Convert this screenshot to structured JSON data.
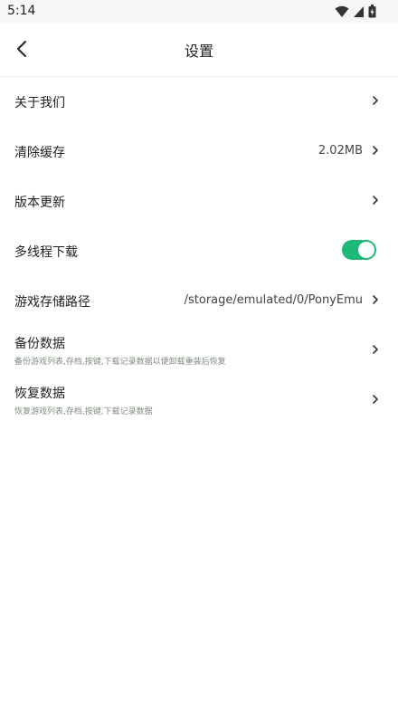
{
  "status_bar": {
    "time": "5:14",
    "icons": [
      "wifi-icon",
      "signal-icon",
      "battery-icon"
    ]
  },
  "header": {
    "title": "设置",
    "back_icon": "back-arrow-icon"
  },
  "settings": {
    "about": {
      "label": "关于我们"
    },
    "clear_cache": {
      "label": "清除缓存",
      "value": "2.02MB"
    },
    "version_update": {
      "label": "版本更新"
    },
    "multi_thread": {
      "label": "多线程下载",
      "enabled": true
    },
    "storage_path": {
      "label": "游戏存储路径",
      "value": "/storage/emulated/0/PonyEmu"
    },
    "backup": {
      "label": "备份数据",
      "sub": "备份游戏列表,存档,按键,下载记录数据以便卸载重装后恢复"
    },
    "restore": {
      "label": "恢复数据",
      "sub": "恢复游戏列表,存档,按键,下载记录数据"
    }
  },
  "colors": {
    "accent": "#1db87a",
    "subtext": "#7f8c7f"
  }
}
